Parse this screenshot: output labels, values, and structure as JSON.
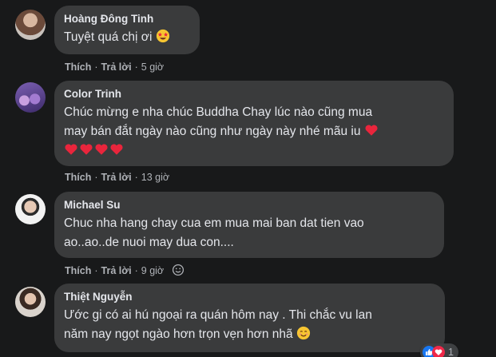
{
  "comments": [
    {
      "author": "Hoàng Đông Tinh",
      "text": "Tuyệt quá chị ơi",
      "like": "Thích",
      "reply": "Trả lời",
      "time": "5 giờ",
      "emoji": "star-struck-emoji"
    },
    {
      "author": "Color Trinh",
      "line1": "Chúc mừng e nha chúc Buddha Chay lúc nào cũng mua",
      "line2": "may bán đắt ngày nào cũng như ngày này nhé mãu iu",
      "like": "Thích",
      "reply": "Trả lời",
      "time": "13 giờ",
      "emoji": "heart-emoji",
      "heart_count": 5
    },
    {
      "author": "Michael Su",
      "line1": "Chuc nha hang chay cua em mua mai ban dat tien vao",
      "line2": "ao..ao..de nuoi may dua con....",
      "like": "Thích",
      "reply": "Trả lời",
      "time": "9 giờ",
      "emoji": "smile-emoji"
    },
    {
      "author": "Thiệt Nguyễn",
      "line1": "Ước gi có ai hú ngoại ra quán hôm nay . Thi chắc vu lan",
      "line2": "năm nay ngọt ngào hơn trọn vẹn hơn nhã",
      "emoji": "smiling-blush-emoji",
      "reactions": {
        "count": "1",
        "types": [
          "like-icon",
          "heart-icon"
        ]
      }
    }
  ],
  "colors": {
    "background": "#18191a",
    "bubble": "#3a3b3c",
    "text": "#e4e6eb",
    "secondary": "#b0b3b8",
    "like_blue": "#1877f2",
    "heart_red": "#f02849"
  }
}
